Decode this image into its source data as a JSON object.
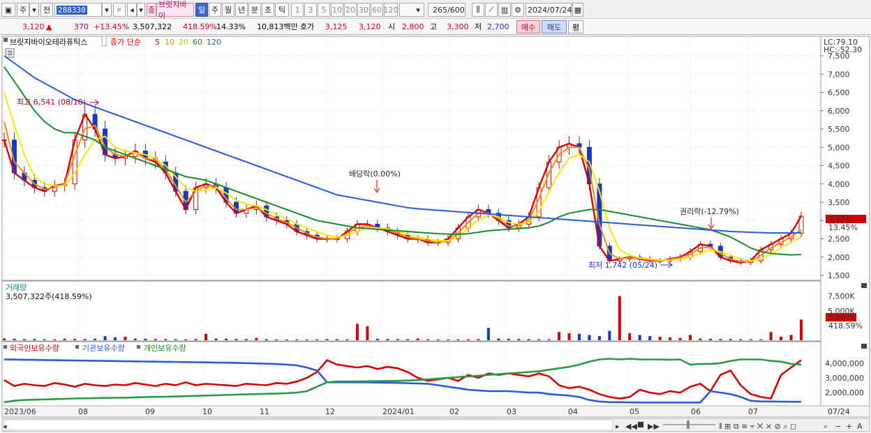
{
  "toolbar": {
    "period_day_label": "주",
    "jeon_label": "전",
    "stock_code": "288330",
    "stock_name": "브릿지바이",
    "stock_name_badge": "종",
    "periods": [
      "일",
      "주",
      "월",
      "년",
      "분",
      "초",
      "틱"
    ],
    "active_period": "일",
    "intervals": [
      "1",
      "3",
      "5",
      "10",
      "20",
      "30",
      "60",
      "120"
    ],
    "count_display": "265",
    "count_total": "/600",
    "date": "2024/07/24"
  },
  "quote": {
    "price": "3,120",
    "change": "370",
    "change_pct": "+13.45%",
    "volume": "3,507,322",
    "volume_ratio": "418.59%",
    "turnover": "14.33%",
    "amount": "10,813백만",
    "ask_label": "호가",
    "ask1": "3,125",
    "ask2": "3,120",
    "open_label": "시",
    "open": "2,800",
    "high_label": "고",
    "high": "3,300",
    "low_label": "저",
    "low": "2,700",
    "buy_label": "매수",
    "sell_label": "매도",
    "flat_label": "평"
  },
  "price_panel": {
    "legend_name": "브릿지바이오테라퓨틱스",
    "legend_kind": "종가 단순",
    "ma_periods": [
      "5",
      "10",
      "20",
      "60",
      "120"
    ],
    "lc_label": "LC:79.10",
    "hc_label": "HC:-52.30",
    "current_price_tag": "3,120",
    "current_pct_tag": "13.45%",
    "annotations": {
      "high": "최고 6,541 (08/10)",
      "low": "최저 1,742 (05/24)",
      "dividend": "배당락(0.00%)",
      "rights": "권리락(-12.79%)"
    }
  },
  "volume_panel": {
    "title": "거래량",
    "value_text": "3,507,322주(418.59%)",
    "tag_value": "3,507K",
    "tag_pct": "418.59%"
  },
  "holdings_panel": {
    "legend": [
      "외국인보유수량",
      "기관보유수량",
      "개인보유수량"
    ]
  },
  "x_axis": {
    "labels": [
      "2023/06",
      "08",
      "09",
      "10",
      "11",
      "12",
      "2024/01",
      "02",
      "03",
      "04",
      "05",
      "06",
      "07"
    ],
    "end_label": "07/24"
  },
  "chart_data": [
    {
      "type": "line",
      "title": "",
      "x_range": [
        "2023/06",
        "2024/07/24"
      ],
      "ylim": [
        1500,
        7500
      ],
      "y_ticks": [
        1500,
        2000,
        2500,
        3000,
        3500,
        4000,
        4500,
        5000,
        5500,
        6000,
        6500,
        7000,
        7500
      ],
      "y_tick_labels": [
        "1,500",
        "2,000",
        "2,500",
        "3,000",
        "3,500",
        "4,000",
        "4,500",
        "5,000",
        "5,500",
        "6,000",
        "6,500",
        "7,000",
        "7,500"
      ],
      "series": [
        {
          "name": "5",
          "color": "#d40000",
          "values": [
            5200,
            4300,
            4100,
            3900,
            3800,
            3950,
            4000,
            5200,
            5900,
            5500,
            4800,
            4700,
            4750,
            4900,
            4700,
            4600,
            4300,
            3800,
            3300,
            3900,
            4000,
            3900,
            3500,
            3200,
            3300,
            3400,
            3100,
            3000,
            2900,
            2700,
            2600,
            2500,
            2500,
            2500,
            2700,
            2900,
            2900,
            2800,
            2700,
            2600,
            2500,
            2500,
            2400,
            2400,
            2500,
            2800,
            3100,
            3300,
            3200,
            3000,
            2800,
            2900,
            3100,
            3900,
            4600,
            5000,
            5100,
            5000,
            4000,
            2300,
            1900,
            1950,
            2000,
            1950,
            1900,
            1900,
            1950,
            2000,
            2150,
            2350,
            2300,
            2000,
            1900,
            1850,
            1900,
            2200,
            2350,
            2500,
            2650,
            3120
          ]
        },
        {
          "name": "10",
          "color": "#f08c1a",
          "values": [
            5700,
            4600,
            4300,
            4000,
            3850,
            3900,
            4000,
            4800,
            5500,
            5600,
            5000,
            4800,
            4750,
            4850,
            4700,
            4650,
            4400,
            3950,
            3500,
            3800,
            3950,
            3950,
            3600,
            3300,
            3300,
            3350,
            3200,
            3050,
            2950,
            2800,
            2650,
            2550,
            2500,
            2500,
            2650,
            2800,
            2850,
            2800,
            2750,
            2650,
            2550,
            2500,
            2450,
            2400,
            2450,
            2650,
            2950,
            3200,
            3200,
            3050,
            2850,
            2850,
            3000,
            3600,
            4300,
            4800,
            5000,
            5000,
            4400,
            2900,
            2100,
            1950,
            1980,
            1960,
            1920,
            1900,
            1930,
            1980,
            2080,
            2250,
            2270,
            2100,
            1950,
            1880,
            1880,
            2050,
            2250,
            2400,
            2550,
            2750
          ]
        },
        {
          "name": "20",
          "color": "#ffe600",
          "values": [
            6500,
            5600,
            4800,
            4200,
            4000,
            3950,
            3950,
            4300,
            4800,
            5200,
            5300,
            5000,
            4900,
            4850,
            4800,
            4700,
            4500,
            4200,
            3900,
            3800,
            3850,
            3900,
            3750,
            3550,
            3450,
            3400,
            3300,
            3150,
            3050,
            2900,
            2800,
            2700,
            2600,
            2550,
            2600,
            2700,
            2800,
            2800,
            2780,
            2700,
            2620,
            2550,
            2500,
            2450,
            2450,
            2550,
            2800,
            3000,
            3150,
            3100,
            2950,
            2900,
            2950,
            3250,
            3800,
            4300,
            4700,
            4800,
            4600,
            3800,
            2800,
            2200,
            2050,
            1980,
            1950,
            1920,
            1920,
            1950,
            2000,
            2100,
            2200,
            2150,
            2050,
            1950,
            1900,
            1950,
            2080,
            2250,
            2400,
            2550
          ]
        },
        {
          "name": "60",
          "color": "#1a8a2a",
          "values": [
            7200,
            6800,
            6400,
            6000,
            5700,
            5500,
            5400,
            5400,
            5300,
            5200,
            5000,
            4900,
            4800,
            4700,
            4600,
            4500,
            4400,
            4300,
            4200,
            4150,
            4100,
            4000,
            3900,
            3800,
            3700,
            3600,
            3500,
            3400,
            3300,
            3200,
            3100,
            3000,
            2950,
            2900,
            2850,
            2800,
            2780,
            2760,
            2740,
            2720,
            2700,
            2680,
            2660,
            2640,
            2630,
            2620,
            2640,
            2680,
            2720,
            2740,
            2760,
            2780,
            2800,
            2850,
            2950,
            3100,
            3200,
            3250,
            3300,
            3300,
            3250,
            3200,
            3150,
            3100,
            3050,
            3000,
            2950,
            2900,
            2850,
            2800,
            2750,
            2650,
            2550,
            2400,
            2250,
            2150,
            2100,
            2080,
            2060,
            2070
          ]
        },
        {
          "name": "120",
          "color": "#2a5ad8",
          "values": [
            7500,
            7300,
            7100,
            6900,
            6750,
            6600,
            6450,
            6300,
            6200,
            6100,
            6000,
            5900,
            5800,
            5700,
            5600,
            5500,
            5400,
            5300,
            5200,
            5100,
            5000,
            4900,
            4800,
            4700,
            4600,
            4500,
            4400,
            4300,
            4200,
            4100,
            4000,
            3900,
            3800,
            3700,
            3650,
            3600,
            3550,
            3500,
            3450,
            3400,
            3350,
            3320,
            3300,
            3280,
            3260,
            3240,
            3220,
            3200,
            3180,
            3160,
            3140,
            3120,
            3100,
            3080,
            3060,
            3040,
            3020,
            3000,
            2980,
            2960,
            2940,
            2920,
            2900,
            2880,
            2860,
            2840,
            2820,
            2800,
            2780,
            2760,
            2740,
            2720,
            2700,
            2690,
            2680,
            2670,
            2660,
            2660,
            2660,
            2670
          ]
        }
      ]
    },
    {
      "type": "bar",
      "title": "거래량",
      "ylim": [
        0,
        9000000
      ],
      "y_tick_labels": [
        "7,500K",
        "5,000K"
      ],
      "values": [
        300,
        250,
        200,
        220,
        180,
        150,
        260,
        230,
        200,
        260,
        700,
        500,
        600,
        300,
        250,
        220,
        200,
        180,
        160,
        200,
        1100,
        300,
        260,
        220,
        200,
        400,
        180,
        150,
        130,
        140,
        120,
        150,
        200,
        180,
        160,
        2800,
        2400,
        260,
        220,
        200,
        180,
        300,
        160,
        150,
        130,
        140,
        160,
        200,
        2100,
        300,
        260,
        220,
        200,
        180,
        160,
        1400,
        1200,
        1100,
        900,
        700,
        1600,
        7500,
        1200,
        900,
        700,
        600,
        500,
        400,
        900,
        300,
        250,
        220,
        200,
        180,
        160,
        150,
        1400,
        600,
        900,
        3507
      ]
    },
    {
      "type": "line",
      "title": "보유수량",
      "ylim": [
        1200000,
        4700000
      ],
      "y_tick_labels": [
        "4,000,000",
        "3,000,000",
        "2,000,000"
      ],
      "series": [
        {
          "name": "외국인보유수량",
          "color": "#d40000",
          "values": [
            2850,
            2450,
            2600,
            2500,
            2450,
            2650,
            2550,
            2400,
            2600,
            2500,
            2450,
            2550,
            2500,
            2650,
            2550,
            2450,
            2600,
            2500,
            2700,
            2500,
            2600,
            2550,
            2500,
            2450,
            2600,
            2550,
            2500,
            2650,
            2600,
            2750,
            3000,
            3400,
            4200,
            3900,
            3800,
            3700,
            3800,
            3600,
            3750,
            3650,
            3400,
            3000,
            2800,
            2900,
            3000,
            2800,
            3200,
            3000,
            3300,
            3200,
            3300,
            3200,
            3100,
            3300,
            3100,
            2500,
            2300,
            2400,
            2200,
            1900,
            1700,
            1600,
            1700,
            2200,
            2000,
            1900,
            2100,
            2000,
            2400,
            2600,
            2100,
            3200,
            3500,
            2500,
            1900,
            1700,
            1600,
            3200,
            3700,
            4200
          ]
        },
        {
          "name": "기관보유수량",
          "color": "#2a5ad8",
          "values": [
            4250,
            4240,
            4230,
            4220,
            4210,
            4200,
            4190,
            4180,
            4170,
            4160,
            4150,
            4140,
            4130,
            4120,
            4110,
            4100,
            4090,
            4080,
            4070,
            4060,
            4050,
            4040,
            4030,
            4020,
            4000,
            3980,
            3960,
            3940,
            3900,
            3850,
            3700,
            3500,
            2700,
            2700,
            2700,
            2700,
            2690,
            2680,
            2670,
            2660,
            2640,
            2620,
            2600,
            2500,
            2400,
            2300,
            2200,
            2150,
            2100,
            2100,
            2100,
            2050,
            2000,
            2000,
            1900,
            1850,
            1800,
            1700,
            1500,
            1400,
            1350,
            1350,
            1340,
            1330,
            1330,
            1330,
            1330,
            1330,
            1330,
            1330,
            2100,
            2000,
            1900,
            1700,
            1450,
            1400,
            1400,
            1390,
            1380,
            1380
          ]
        },
        {
          "name": "개인보유수량",
          "color": "#2a9a48",
          "values": [
            1350,
            1450,
            1500,
            1520,
            1540,
            1560,
            1580,
            1600,
            1610,
            1620,
            1640,
            1650,
            1660,
            1680,
            1700,
            1710,
            1720,
            1740,
            1760,
            1780,
            1800,
            1820,
            1840,
            1860,
            1880,
            1900,
            1920,
            1940,
            1960,
            2000,
            2100,
            2400,
            2700,
            2750,
            2760,
            2760,
            2770,
            2780,
            2790,
            2800,
            2820,
            2850,
            2900,
            2950,
            3000,
            3050,
            3100,
            3150,
            3200,
            3250,
            3300,
            3350,
            3400,
            3450,
            3550,
            3650,
            3750,
            3900,
            4100,
            4250,
            4300,
            4250,
            4300,
            4250,
            4250,
            4250,
            4230,
            4250,
            3900,
            3950,
            3950,
            4000,
            4150,
            4250,
            4250,
            4250,
            4150,
            4100,
            3950,
            3900
          ]
        }
      ]
    }
  ],
  "colors": {
    "up": "#d40000",
    "down": "#1638c8",
    "grid": "#dcdcdc"
  }
}
